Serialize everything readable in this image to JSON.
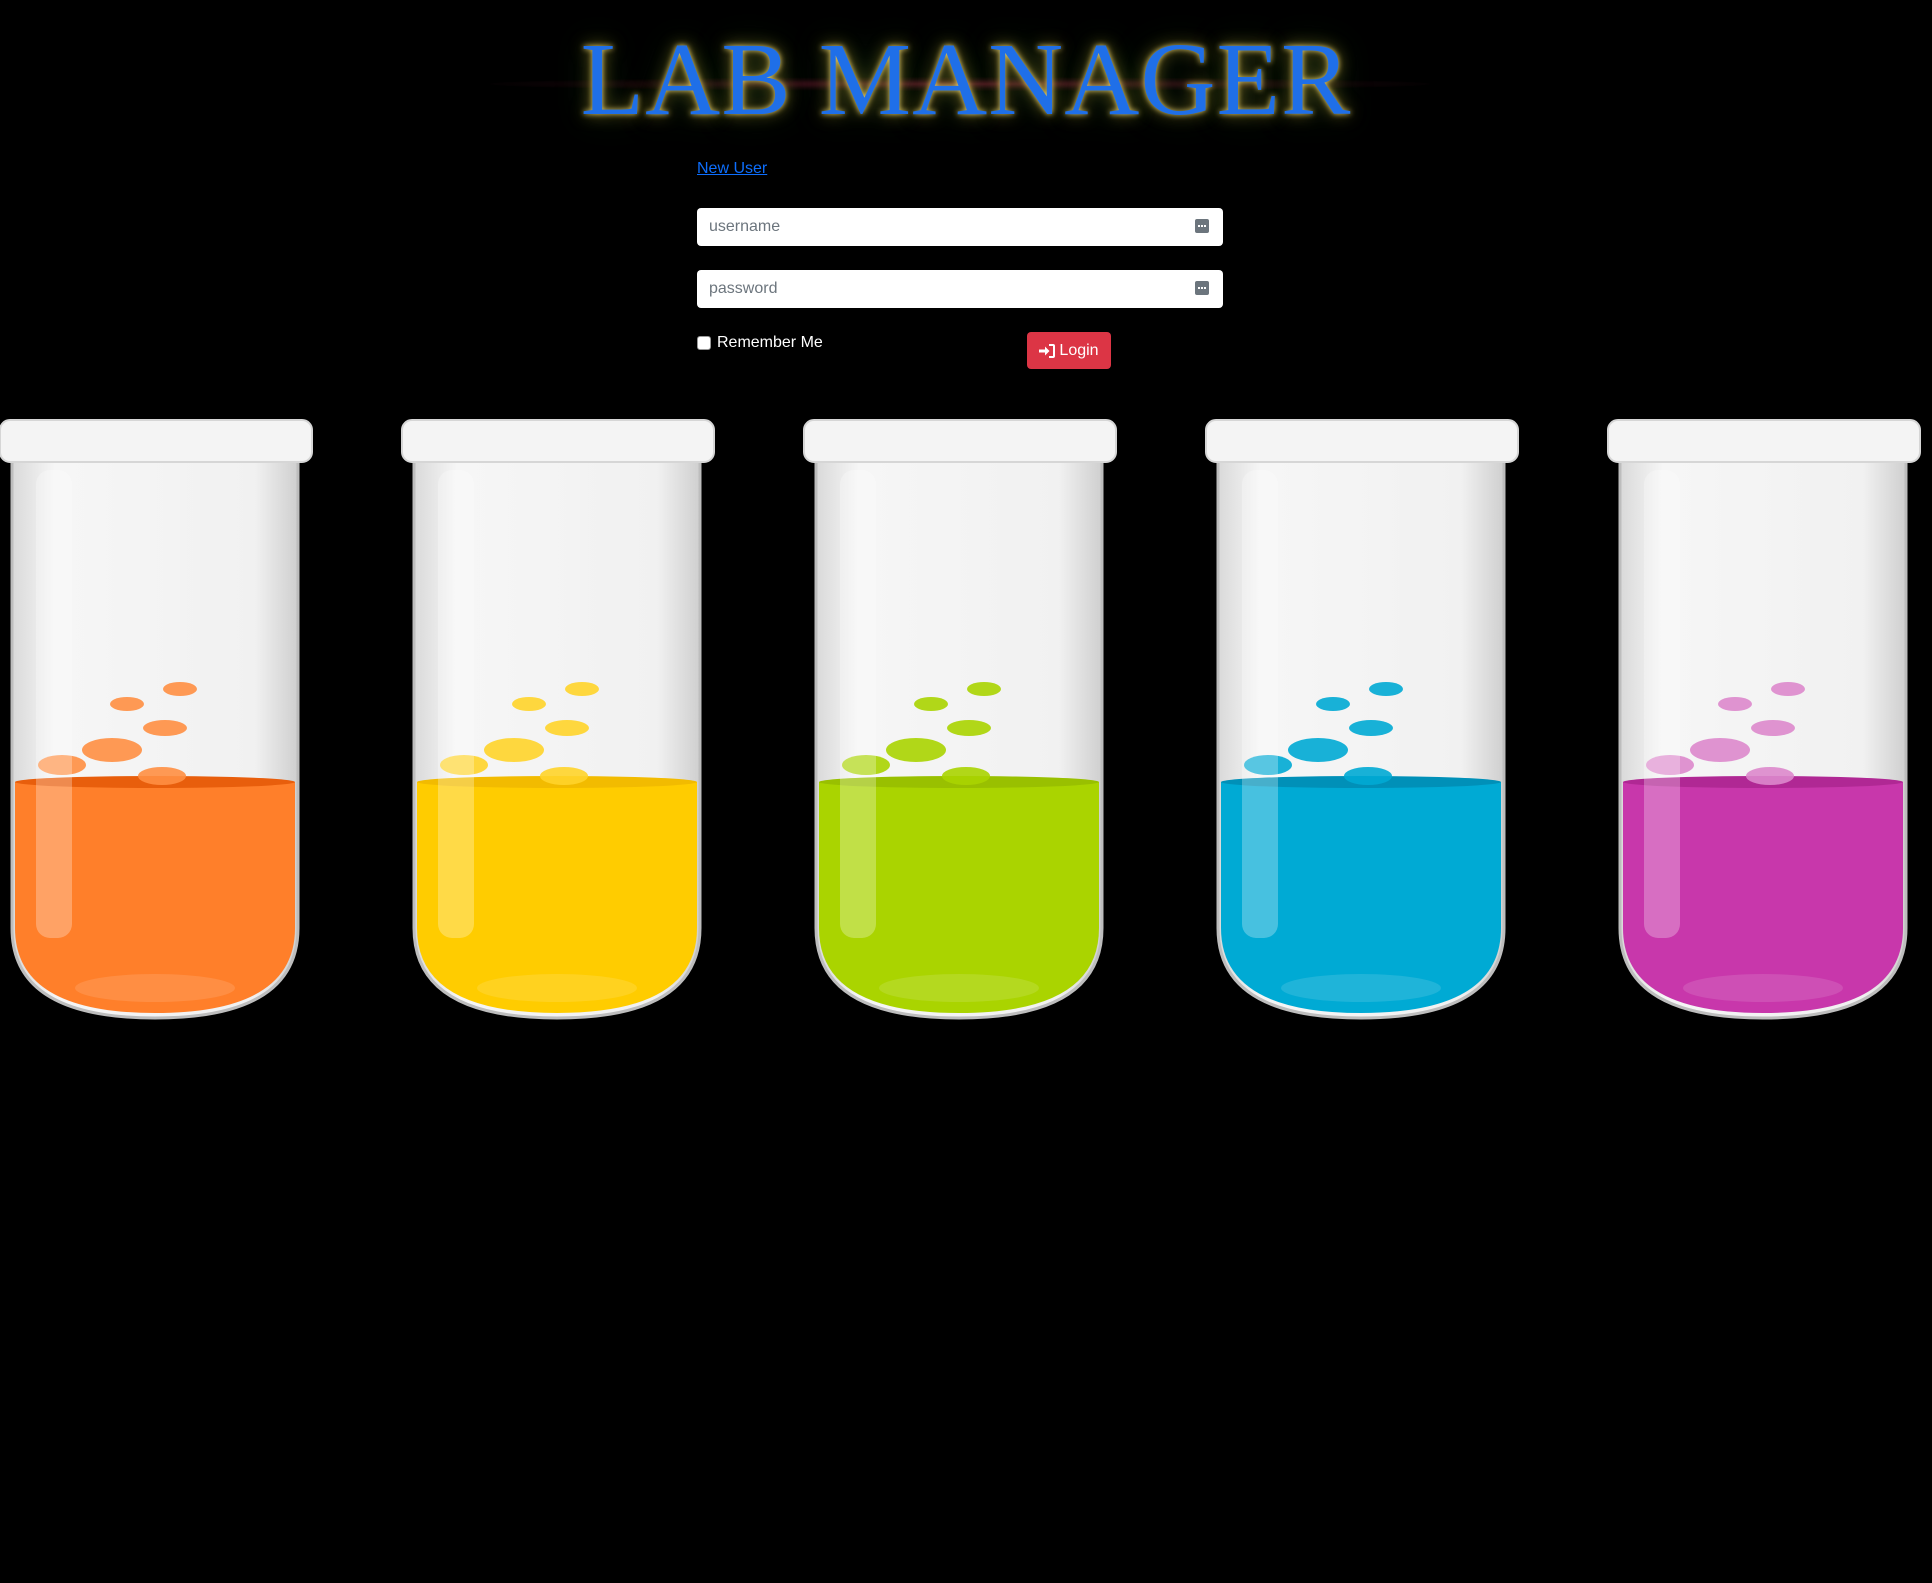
{
  "header": {
    "title": "LAB MANAGER"
  },
  "links": {
    "new_user": "New User"
  },
  "form": {
    "username_placeholder": "username",
    "password_placeholder": "password",
    "remember_label": "Remember Me",
    "login_label": "Login"
  },
  "tubes": [
    {
      "name": "orange",
      "liquid": "#ff7f2a",
      "dark": "#e85e0c",
      "bubble": "#ff8f42"
    },
    {
      "name": "yellow",
      "liquid": "#ffcc00",
      "dark": "#f2bb00",
      "bubble": "#ffd42a"
    },
    {
      "name": "green",
      "liquid": "#aad400",
      "dark": "#99c000",
      "bubble": "#aad400"
    },
    {
      "name": "blue",
      "liquid": "#00aad4",
      "dark": "#0090b8",
      "bubble": "#00aad4"
    },
    {
      "name": "magenta",
      "liquid": "#c837ab",
      "dark": "#b02894",
      "bubble": "#dd88cc"
    }
  ]
}
